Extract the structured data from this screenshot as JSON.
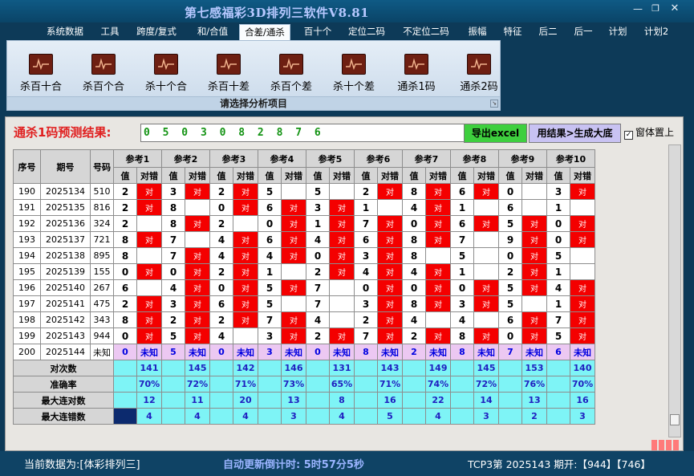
{
  "window": {
    "title": "第七感福彩3D排列三软件V8.81",
    "minimize_icon": "minimize-icon",
    "restore_icon": "restore-icon",
    "close_icon": "close-icon"
  },
  "menu": [
    "系统数据",
    "工具",
    "跨度/复式",
    "和/合值",
    "合差/通杀",
    "百十个",
    "定位二码",
    "不定位二码",
    "振幅",
    "特征",
    "后二",
    "后一",
    "计划",
    "计划2"
  ],
  "menu_active": "合差/通杀",
  "ribbon": {
    "buttons": [
      "杀百十合",
      "杀百个合",
      "杀十个合",
      "杀百十差",
      "杀百个差",
      "杀十个差",
      "通杀1码",
      "通杀2码"
    ],
    "caption": "请选择分析项目"
  },
  "result": {
    "label": "通杀1码预测结果:",
    "value": "0 5 0 3 0 8 2 8 7 6",
    "export_label": "导出excel",
    "generate_label": "用结果>生成大底",
    "topmost_label": "窗体置上",
    "topmost_checked": true
  },
  "table": {
    "headers": {
      "seq": "序号",
      "period": "期号",
      "number": "号码",
      "groups": [
        "参考1",
        "参考2",
        "参考3",
        "参考4",
        "参考5",
        "参考6",
        "参考7",
        "参考8",
        "参考9",
        "参考10"
      ],
      "sub_value": "值",
      "sub_result": "对错"
    },
    "hit_text": "对",
    "rows": [
      {
        "seq": "190",
        "period": "2025134",
        "num": "510",
        "vals": [
          "2",
          "3",
          "2",
          "5",
          "5",
          "2",
          "8",
          "6",
          "0",
          "3"
        ],
        "red": [
          true,
          false,
          false,
          false,
          false,
          false,
          false,
          false,
          true,
          true
        ],
        "hit": [
          true,
          true,
          true,
          false,
          false,
          true,
          true,
          true,
          false,
          true
        ]
      },
      {
        "seq": "191",
        "period": "2025135",
        "num": "816",
        "vals": [
          "2",
          "8",
          "0",
          "6",
          "3",
          "1",
          "4",
          "1",
          "6",
          "1"
        ],
        "red": [
          false,
          true,
          false,
          true,
          false,
          true,
          false,
          true,
          true,
          true
        ],
        "hit": [
          true,
          false,
          true,
          true,
          true,
          false,
          true,
          false,
          false,
          false
        ]
      },
      {
        "seq": "192",
        "period": "2025136",
        "num": "324",
        "vals": [
          "2",
          "8",
          "2",
          "0",
          "1",
          "7",
          "0",
          "6",
          "5",
          "0"
        ],
        "red": [
          true,
          false,
          true,
          false,
          false,
          false,
          false,
          false,
          false,
          false
        ],
        "hit": [
          false,
          true,
          false,
          true,
          true,
          true,
          true,
          true,
          true,
          true
        ]
      },
      {
        "seq": "193",
        "period": "2025137",
        "num": "721",
        "vals": [
          "8",
          "7",
          "4",
          "6",
          "4",
          "6",
          "8",
          "7",
          "9",
          "0"
        ],
        "red": [
          false,
          true,
          false,
          false,
          false,
          false,
          false,
          true,
          false,
          false
        ],
        "hit": [
          true,
          false,
          true,
          true,
          true,
          true,
          true,
          false,
          true,
          true
        ]
      },
      {
        "seq": "194",
        "period": "2025138",
        "num": "895",
        "vals": [
          "8",
          "7",
          "4",
          "4",
          "0",
          "3",
          "8",
          "5",
          "0",
          "5"
        ],
        "red": [
          true,
          false,
          false,
          false,
          false,
          false,
          true,
          true,
          false,
          true
        ],
        "hit": [
          false,
          true,
          true,
          true,
          true,
          true,
          false,
          false,
          true,
          false
        ]
      },
      {
        "seq": "195",
        "period": "2025139",
        "num": "155",
        "vals": [
          "0",
          "0",
          "2",
          "1",
          "2",
          "4",
          "4",
          "1",
          "2",
          "1"
        ],
        "red": [
          false,
          false,
          false,
          true,
          false,
          false,
          false,
          true,
          false,
          true
        ],
        "hit": [
          true,
          true,
          true,
          false,
          true,
          true,
          true,
          false,
          true,
          false
        ]
      },
      {
        "seq": "196",
        "period": "2025140",
        "num": "267",
        "vals": [
          "6",
          "4",
          "0",
          "5",
          "7",
          "0",
          "0",
          "0",
          "5",
          "4"
        ],
        "red": [
          true,
          false,
          false,
          false,
          true,
          false,
          false,
          false,
          false,
          false
        ],
        "hit": [
          false,
          true,
          true,
          true,
          false,
          true,
          true,
          true,
          true,
          true
        ]
      },
      {
        "seq": "197",
        "period": "2025141",
        "num": "475",
        "vals": [
          "2",
          "3",
          "6",
          "5",
          "7",
          "3",
          "8",
          "3",
          "5",
          "1"
        ],
        "red": [
          false,
          false,
          false,
          true,
          true,
          false,
          false,
          false,
          true,
          false
        ],
        "hit": [
          true,
          true,
          true,
          false,
          false,
          true,
          true,
          true,
          false,
          true
        ]
      },
      {
        "seq": "198",
        "period": "2025142",
        "num": "343",
        "vals": [
          "8",
          "2",
          "2",
          "7",
          "4",
          "2",
          "4",
          "4",
          "6",
          "7"
        ],
        "red": [
          false,
          false,
          false,
          false,
          true,
          false,
          true,
          true,
          false,
          false
        ],
        "hit": [
          true,
          true,
          true,
          true,
          false,
          true,
          false,
          false,
          true,
          true
        ]
      },
      {
        "seq": "199",
        "period": "2025143",
        "num": "944",
        "vals": [
          "0",
          "5",
          "4",
          "3",
          "2",
          "7",
          "2",
          "8",
          "0",
          "5"
        ],
        "red": [
          false,
          false,
          true,
          false,
          false,
          false,
          false,
          false,
          false,
          false
        ],
        "hit": [
          true,
          true,
          false,
          true,
          true,
          true,
          true,
          true,
          true,
          true
        ]
      }
    ],
    "predict_row": {
      "seq": "200",
      "period": "2025144",
      "num": "未知",
      "vals": [
        "0",
        "5",
        "0",
        "3",
        "0",
        "8",
        "2",
        "8",
        "7",
        "6"
      ],
      "unknown": "未知"
    },
    "stats": [
      {
        "label": "对次数",
        "vals": [
          "141",
          "145",
          "142",
          "146",
          "131",
          "143",
          "149",
          "145",
          "153",
          "140"
        ]
      },
      {
        "label": "准确率",
        "vals": [
          "70%",
          "72%",
          "71%",
          "73%",
          "65%",
          "71%",
          "74%",
          "72%",
          "76%",
          "70%"
        ]
      },
      {
        "label": "最大连对数",
        "vals": [
          "12",
          "11",
          "20",
          "13",
          "8",
          "16",
          "22",
          "14",
          "13",
          "16"
        ]
      },
      {
        "label": "最大连错数",
        "vals": [
          "4",
          "4",
          "4",
          "3",
          "4",
          "5",
          "4",
          "3",
          "2",
          "3"
        ]
      }
    ]
  },
  "status": {
    "source": "当前数据为:[体彩排列三]",
    "countdown": "自动更新倒计时:  5时57分5秒",
    "draw": "TCP3第 2025143 期开:【944】【746】"
  },
  "colors": {
    "hit": "#f40000",
    "stat": "#7ef4f6",
    "predict": "#ecc8f2",
    "excel": "#3ecf3e",
    "generate": "#c8c2f2"
  }
}
